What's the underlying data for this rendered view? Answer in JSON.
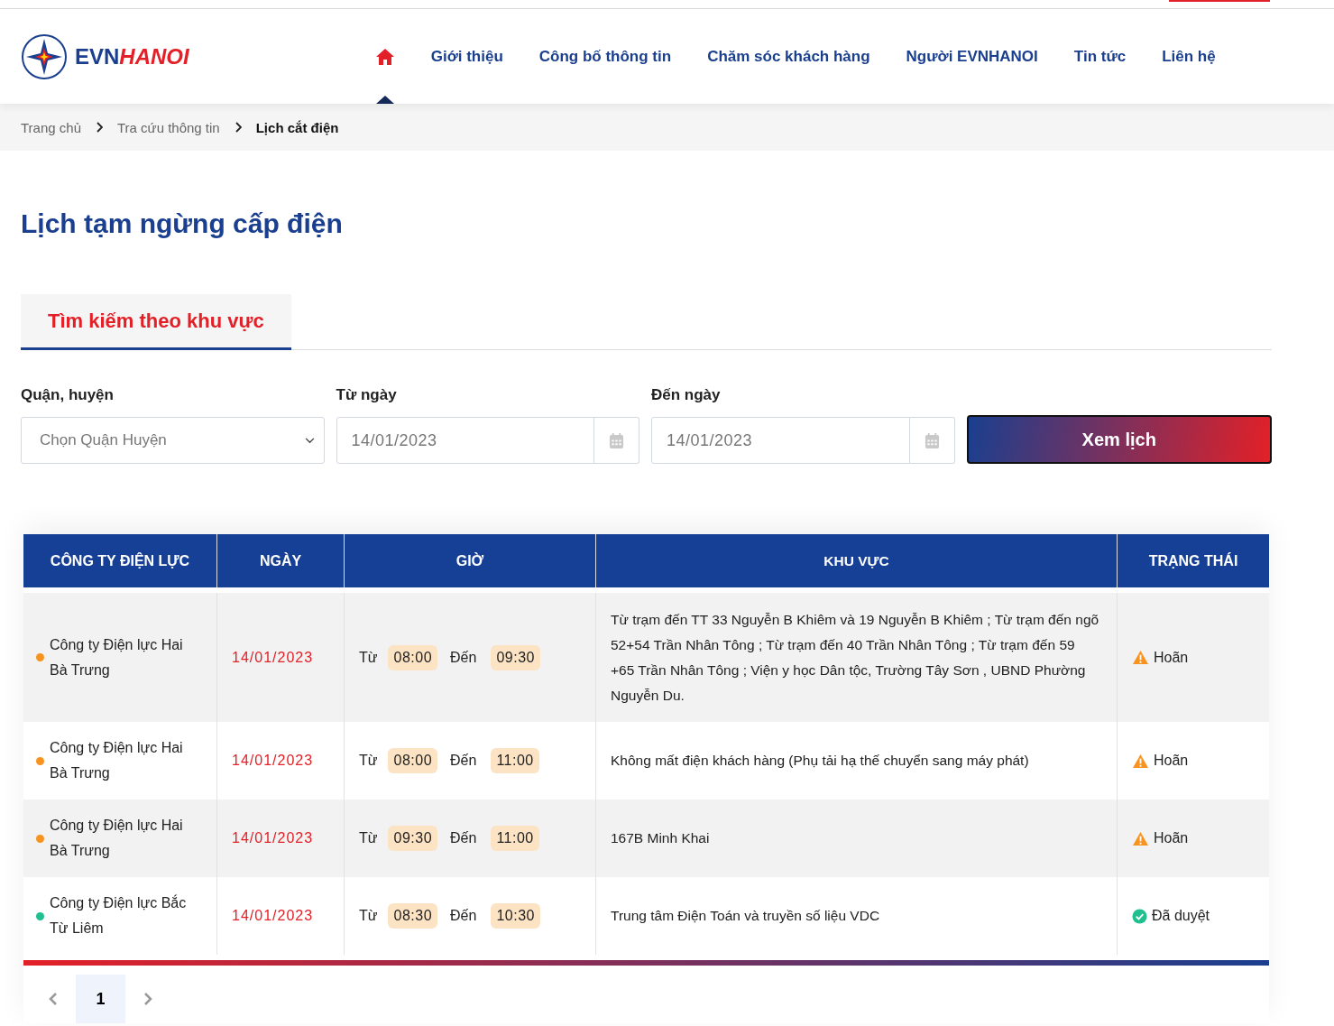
{
  "logo": {
    "part_1": "EVN",
    "part_2": "HANOI"
  },
  "nav": {
    "items": [
      {
        "kind": "home",
        "selected": true
      },
      {
        "kind": "link",
        "label": "Giới thiệu",
        "selected": false
      },
      {
        "kind": "link",
        "label": "Công bố thông tin",
        "selected": false
      },
      {
        "kind": "link",
        "label": "Chăm sóc khách hàng",
        "selected": false
      },
      {
        "kind": "link",
        "label": "Người EVNHANOI",
        "selected": false
      },
      {
        "kind": "link",
        "label": "Tin tức",
        "selected": false
      },
      {
        "kind": "link",
        "label": "Liên hệ",
        "selected": false
      }
    ]
  },
  "breadcrumb": [
    "Trang chủ",
    "Tra cứu thông tin",
    "Lịch cắt điện"
  ],
  "page_title": "Lịch tạm ngừng cấp điện",
  "tabs": [
    {
      "label": "Tìm kiếm theo khu vực",
      "selected": true
    }
  ],
  "filters": {
    "district": {
      "label": "Quận, huyện",
      "placeholder": "Chọn Quận Huyện"
    },
    "from_date": {
      "label": "Từ ngày",
      "value": "14/01/2023"
    },
    "to_date": {
      "label": "Đến ngày",
      "value": "14/01/2023"
    },
    "submit": "Xem lịch"
  },
  "table": {
    "columns": [
      "CÔNG TY ĐIỆN LỰC",
      "NGÀY",
      "GIỜ",
      "KHU VỰC",
      "TRẠNG THÁI"
    ],
    "rows": [
      {
        "company": "Công ty Điện lực Hai Bà Trưng",
        "color": "#f7931e",
        "date": "14/01/2023",
        "from_label": "Từ",
        "from": "08:00",
        "to_label": "Đến",
        "to": "09:30",
        "area": "Từ trạm đến TT 33 Nguyễn B Khiêm và 19 Nguyễn B Khiêm ; Từ trạm đến ngõ 52+54 Trần Nhân Tông ; Từ trạm đến 40 Trần Nhân Tông ; Từ trạm đến 59 +65 Trần Nhân Tông ; Viện y học Dân tộc, Trường Tây Sơn , UBND Phường Nguyễn Du.",
        "status": {
          "kind": "postponed",
          "label": "Hoãn"
        }
      },
      {
        "company": "Công ty Điện lực Hai Bà Trưng",
        "color": "#f7931e",
        "date": "14/01/2023",
        "from_label": "Từ",
        "from": "08:00",
        "to_label": "Đến",
        "to": "11:00",
        "area": "Không mất điện khách hàng (Phụ tải hạ thế chuyển sang máy phát)",
        "status": {
          "kind": "postponed",
          "label": "Hoãn"
        }
      },
      {
        "company": "Công ty Điện lực Hai Bà Trưng",
        "color": "#f7931e",
        "date": "14/01/2023",
        "from_label": "Từ",
        "from": "09:30",
        "to_label": "Đến",
        "to": "11:00",
        "area": "167B Minh Khai",
        "status": {
          "kind": "postponed",
          "label": "Hoãn"
        }
      },
      {
        "company": "Công ty Điện lực Bắc Từ Liêm",
        "color": "#1fbf8f",
        "date": "14/01/2023",
        "from_label": "Từ",
        "from": "08:30",
        "to_label": "Đến",
        "to": "10:30",
        "area": "Trung tâm Điện Toán và truyền số liệu VDC",
        "status": {
          "kind": "approved",
          "label": "Đã duyệt"
        }
      }
    ]
  },
  "pagination": {
    "pages": [
      {
        "label": "1",
        "selected": true
      }
    ]
  }
}
